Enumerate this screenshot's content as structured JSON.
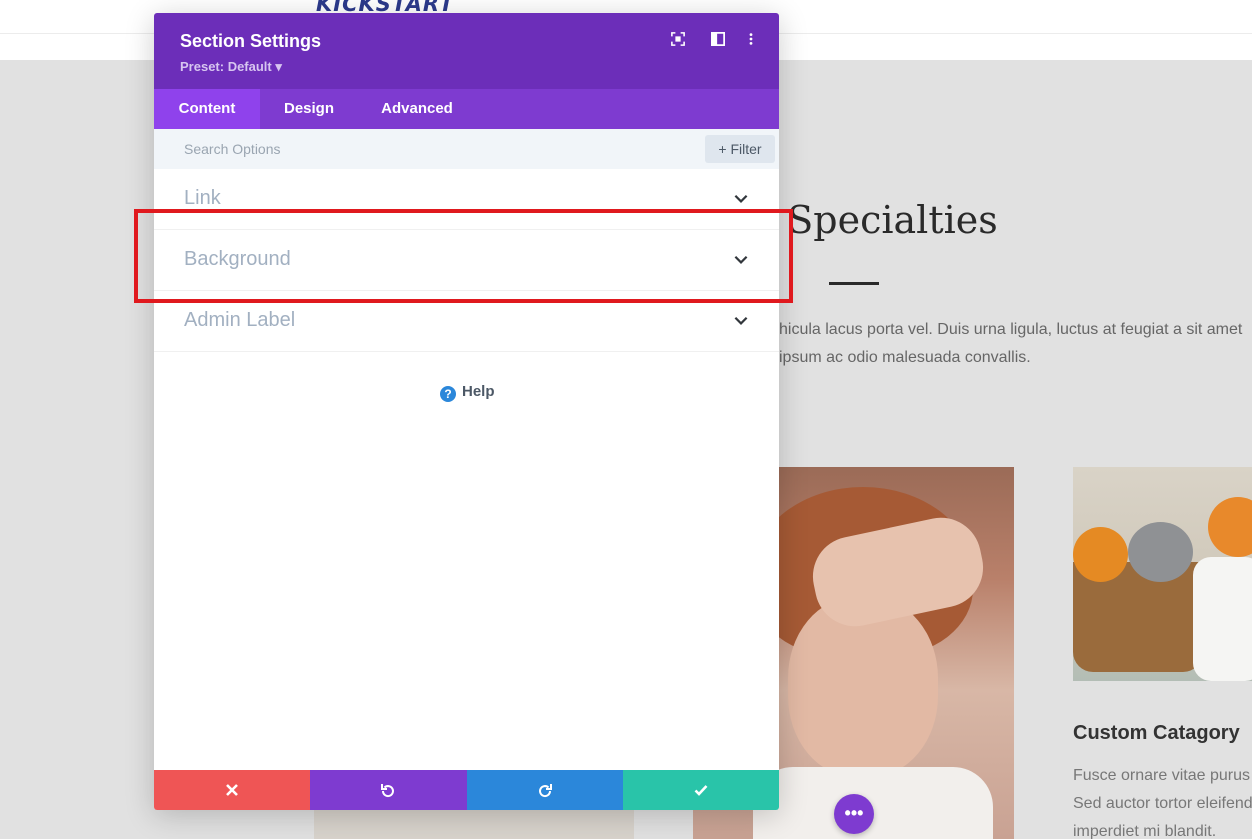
{
  "site": {
    "logo": "KICKSTART",
    "section_title": "r Specialties",
    "section_text": "hicula lacus porta vel. Duis urna ligula, luctus at feugiat a sit amet ipsum ac odio malesuada convallis.",
    "card_title": "Custom Catagory",
    "card_text_lines": [
      "Fusce ornare vitae purus",
      "Sed auctor tortor eleifend",
      "imperdiet mi blandit."
    ],
    "fab_label": "•••"
  },
  "modal": {
    "title": "Section Settings",
    "preset": "Preset: Default ▾",
    "header_icons": [
      "expand-icon",
      "split-view-icon",
      "more-vertical-icon"
    ],
    "tabs": [
      {
        "label": "Content",
        "active": true
      },
      {
        "label": "Design",
        "active": false
      },
      {
        "label": "Advanced",
        "active": false
      }
    ],
    "search_placeholder": "Search Options",
    "filter_label": "+ Filter",
    "toggles": [
      {
        "label": "Link"
      },
      {
        "label": "Background"
      },
      {
        "label": "Admin Label"
      }
    ],
    "help_label": "Help",
    "footer_buttons": [
      {
        "name": "discard-button",
        "icon": "close-icon",
        "color": "#ef5555"
      },
      {
        "name": "undo-button",
        "icon": "undo-icon",
        "color": "#7e3bd0"
      },
      {
        "name": "redo-button",
        "icon": "redo-icon",
        "color": "#2b87da"
      },
      {
        "name": "save-button",
        "icon": "check-icon",
        "color": "#29c4a9"
      }
    ]
  },
  "colors": {
    "header_purple": "#6c2eb9",
    "tabs_purple": "#7e3bd0",
    "active_tab": "#8f42ec",
    "highlight_red": "#e0191e"
  }
}
